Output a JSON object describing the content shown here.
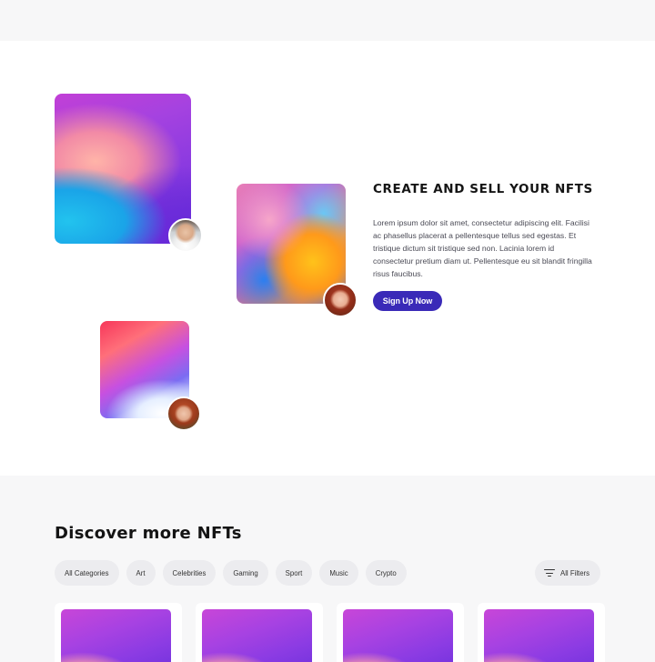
{
  "hero": {
    "heading": "CREATE AND SELL YOUR NFTS",
    "description": "Lorem ipsum dolor sit amet, consectetur adipiscing elit. Facilisi ac phasellus placerat a pellentesque tellus sed egestas. Et tristique dictum sit tristique sed non. Lacinia lorem id consectetur pretium diam ut. Pellentesque eu sit blandit fringilla risus faucibus.",
    "signup_label": "Sign Up Now"
  },
  "discover": {
    "title": "Discover more NFTs",
    "categories": [
      "All Categories",
      "Art",
      "Celebrities",
      "Gaming",
      "Sport",
      "Music",
      "Crypto"
    ],
    "filters_label": "All Filters",
    "filters_icon": "filter-icon"
  },
  "colors": {
    "accent": "#3a2ab8",
    "background": "#f7f7f8"
  }
}
